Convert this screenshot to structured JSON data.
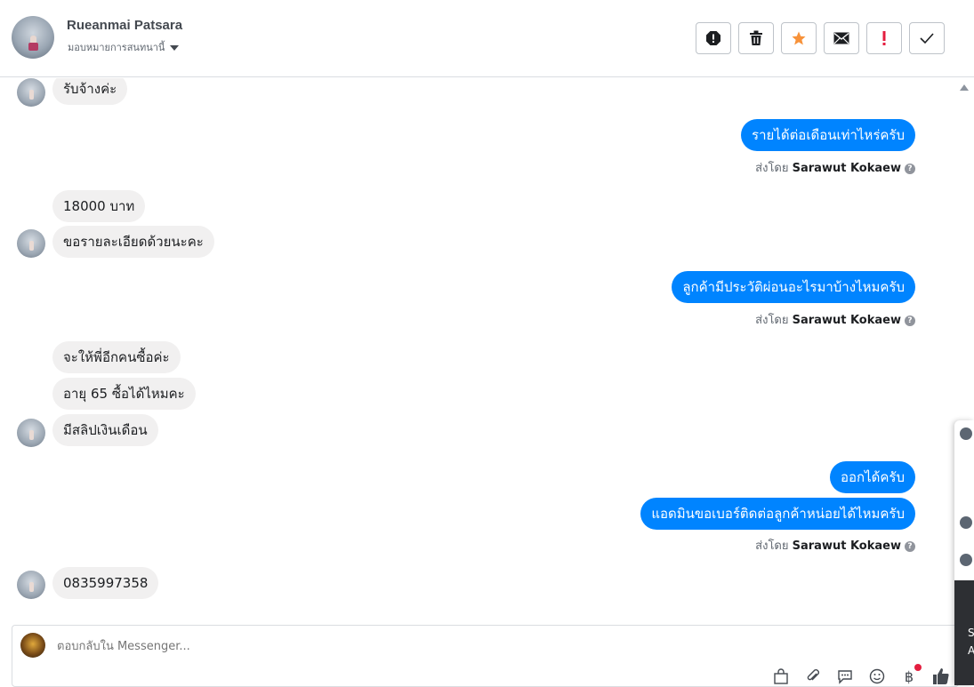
{
  "header": {
    "name": "Rueanmai Patsara",
    "subtitle": "มอบหมายการสนทนานี้"
  },
  "toolbar": {
    "buttons": [
      "report-spam-icon",
      "trash-icon",
      "star-icon",
      "envelope-icon",
      "exclamation-icon",
      "checkmark-icon"
    ],
    "star_color": "#f7923a",
    "alert_color": "#e41e3f"
  },
  "messages": {
    "m1": "รับจ้างค่ะ",
    "m2": "รายได้ต่อเดือนเท่าไหร่ครับ",
    "m3": "18000 บาท",
    "m4": "ขอรายละเอียดด้วยนะคะ",
    "m5": "ลูกค้ามีประวัติผ่อนอะไรมาบ้างไหมครับ",
    "m6": "จะให้พี่อีกคนซื้อค่ะ",
    "m7": "อายุ 65 ซื้อได้ไหมคะ",
    "m8": "มีสลิปเงินเดือน",
    "m9": "ออกได้ครับ",
    "m10": "แอดมินขอเบอร์ติดต่อลูกค้าหน่อยได้ไหมครับ",
    "m11": "0835997358"
  },
  "sent_by": {
    "prefix": "ส่งโดย",
    "agent": "Sarawut Kokaew"
  },
  "composer": {
    "placeholder": "ตอบกลับใน Messenger..."
  },
  "side_panel": {
    "letter1": "S",
    "letter2": "A"
  },
  "colors": {
    "outgoing_bubble": "#0084ff",
    "incoming_bubble": "#f1f0f0"
  }
}
